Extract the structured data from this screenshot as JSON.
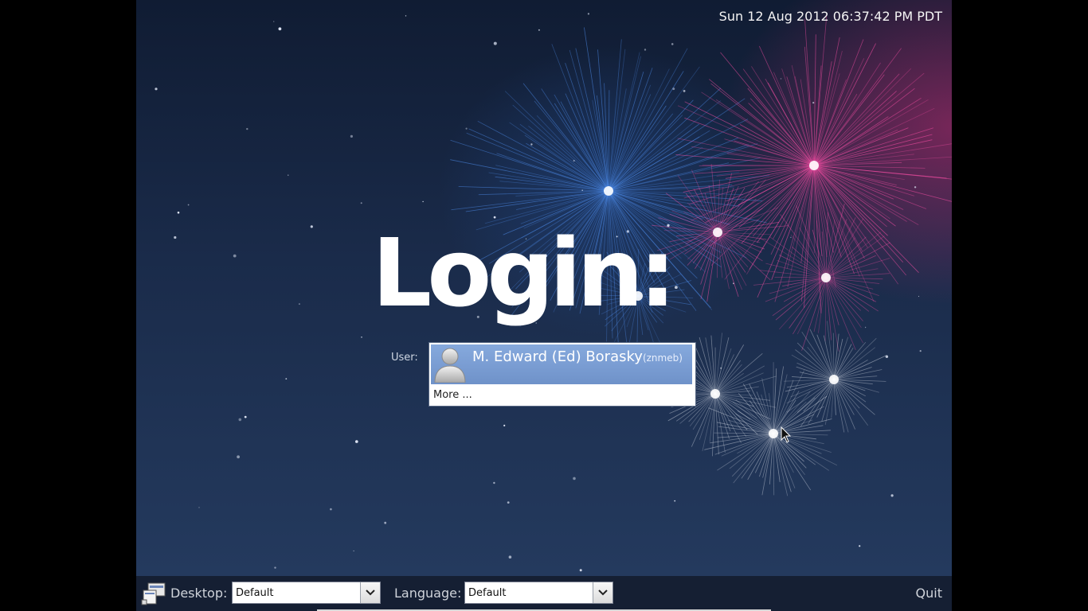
{
  "header": {
    "clock": "Sun 12 Aug 2012 06:37:42 PM PDT"
  },
  "main": {
    "title": "Login:",
    "user_label": "User:",
    "user_list": [
      {
        "display_name": "M. Edward (Ed) Borasky",
        "username": "(znmeb)",
        "selected": true
      }
    ],
    "more_label": "More ..."
  },
  "bottom_bar": {
    "desktop_label": "Desktop:",
    "desktop_value": "Default",
    "language_label": "Language:",
    "language_value": "Default",
    "quit_label": "Quit"
  },
  "colors": {
    "background": "#1a2b4a",
    "selection": "#7798cf",
    "firework_blue": "#4f8ff0",
    "firework_pink": "#ff4fa8"
  },
  "icons": {
    "avatar": "user-silhouette-icon",
    "session": "session-icon",
    "dropdown": "chevron-down-icon",
    "cursor": "mouse-pointer-icon"
  }
}
